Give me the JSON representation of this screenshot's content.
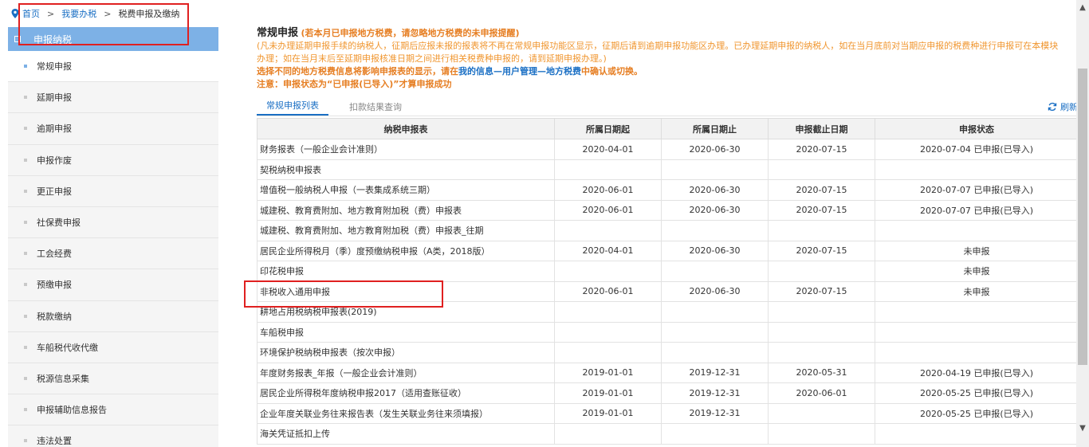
{
  "breadcrumb": {
    "home": "首页",
    "sep": ">",
    "level2": "我要办税",
    "current": "税费申报及缴纳"
  },
  "sidebar": {
    "header": "申报纳税",
    "items": [
      "常规申报",
      "延期申报",
      "逾期申报",
      "申报作废",
      "更正申报",
      "社保费申报",
      "工会经费",
      "预缴申报",
      "税款缴纳",
      "车船税代收代缴",
      "税源信息采集",
      "申报辅助信息报告",
      "违法处置"
    ]
  },
  "notice": {
    "title": "常规申报",
    "title_note": "(若本月已申报地方税费，请忽略地方税费的未申报提醒)",
    "line1": "(凡未办理延期申报手续的纳税人，征期后应报未报的报表将不再在常规申报功能区显示，征期后请到逾期申报功能区办理。已办理延期申报的纳税人，如在当月底前对当期应申报的税费种进行申报可在本模块",
    "line2": "办理；如在当月末后至延期申报核准日期之间进行相关税费种申报的，请到延期申报办理。)",
    "line3_pre": "选择不同的地方税费信息将影响申报表的显示，请在",
    "line3_link": "我的信息—用户管理—地方税费",
    "line3_post": "中确认或切换。",
    "line4": "注意：申报状态为“已申报(已导入)”才算申报成功"
  },
  "tabs": [
    "常规申报列表",
    "扣款结果查询"
  ],
  "refresh_label": "刷新",
  "table": {
    "headers": [
      "纳税申报表",
      "所属日期起",
      "所属日期止",
      "申报截止日期",
      "申报状态"
    ],
    "rows": [
      [
        "财务报表（一般企业会计准则）",
        "2020-04-01",
        "2020-06-30",
        "2020-07-15",
        "2020-07-04 已申报(已导入)"
      ],
      [
        "契税纳税申报表",
        "",
        "",
        "",
        ""
      ],
      [
        "增值税一般纳税人申报（一表集成系统三期）",
        "2020-06-01",
        "2020-06-30",
        "2020-07-15",
        "2020-07-07 已申报(已导入)"
      ],
      [
        "城建税、教育费附加、地方教育附加税（费）申报表",
        "2020-06-01",
        "2020-06-30",
        "2020-07-15",
        "2020-07-07 已申报(已导入)"
      ],
      [
        "城建税、教育费附加、地方教育附加税（费）申报表_往期",
        "",
        "",
        "",
        ""
      ],
      [
        "居民企业所得税月（季）度预缴纳税申报（A类，2018版）",
        "2020-04-01",
        "2020-06-30",
        "2020-07-15",
        "未申报"
      ],
      [
        "印花税申报",
        "",
        "",
        "",
        "未申报"
      ],
      [
        "非税收入通用申报",
        "2020-06-01",
        "2020-06-30",
        "2020-07-15",
        "未申报"
      ],
      [
        "耕地占用税纳税申报表(2019)",
        "",
        "",
        "",
        ""
      ],
      [
        "车船税申报",
        "",
        "",
        "",
        ""
      ],
      [
        "环境保护税纳税申报表（按次申报）",
        "",
        "",
        "",
        ""
      ],
      [
        "年度财务报表_年报（一般企业会计准则）",
        "2019-01-01",
        "2019-12-31",
        "2020-05-31",
        "2020-04-19 已申报(已导入)"
      ],
      [
        "居民企业所得税年度纳税申报2017（适用查账征收）",
        "2019-01-01",
        "2019-12-31",
        "2020-06-01",
        "2020-05-25 已申报(已导入)"
      ],
      [
        "企业年度关联业务往来报告表（发生关联业务往来须填报）",
        "2019-01-01",
        "2019-12-31",
        "",
        "2020-05-25 已申报(已导入)"
      ],
      [
        "海关凭证抵扣上传",
        "",
        "",
        "",
        ""
      ]
    ]
  },
  "colors": {
    "accent": "#1a6fc4",
    "sidebar_header": "#7db1e6",
    "warning": "#e67e22",
    "annotation": "#e02020"
  }
}
